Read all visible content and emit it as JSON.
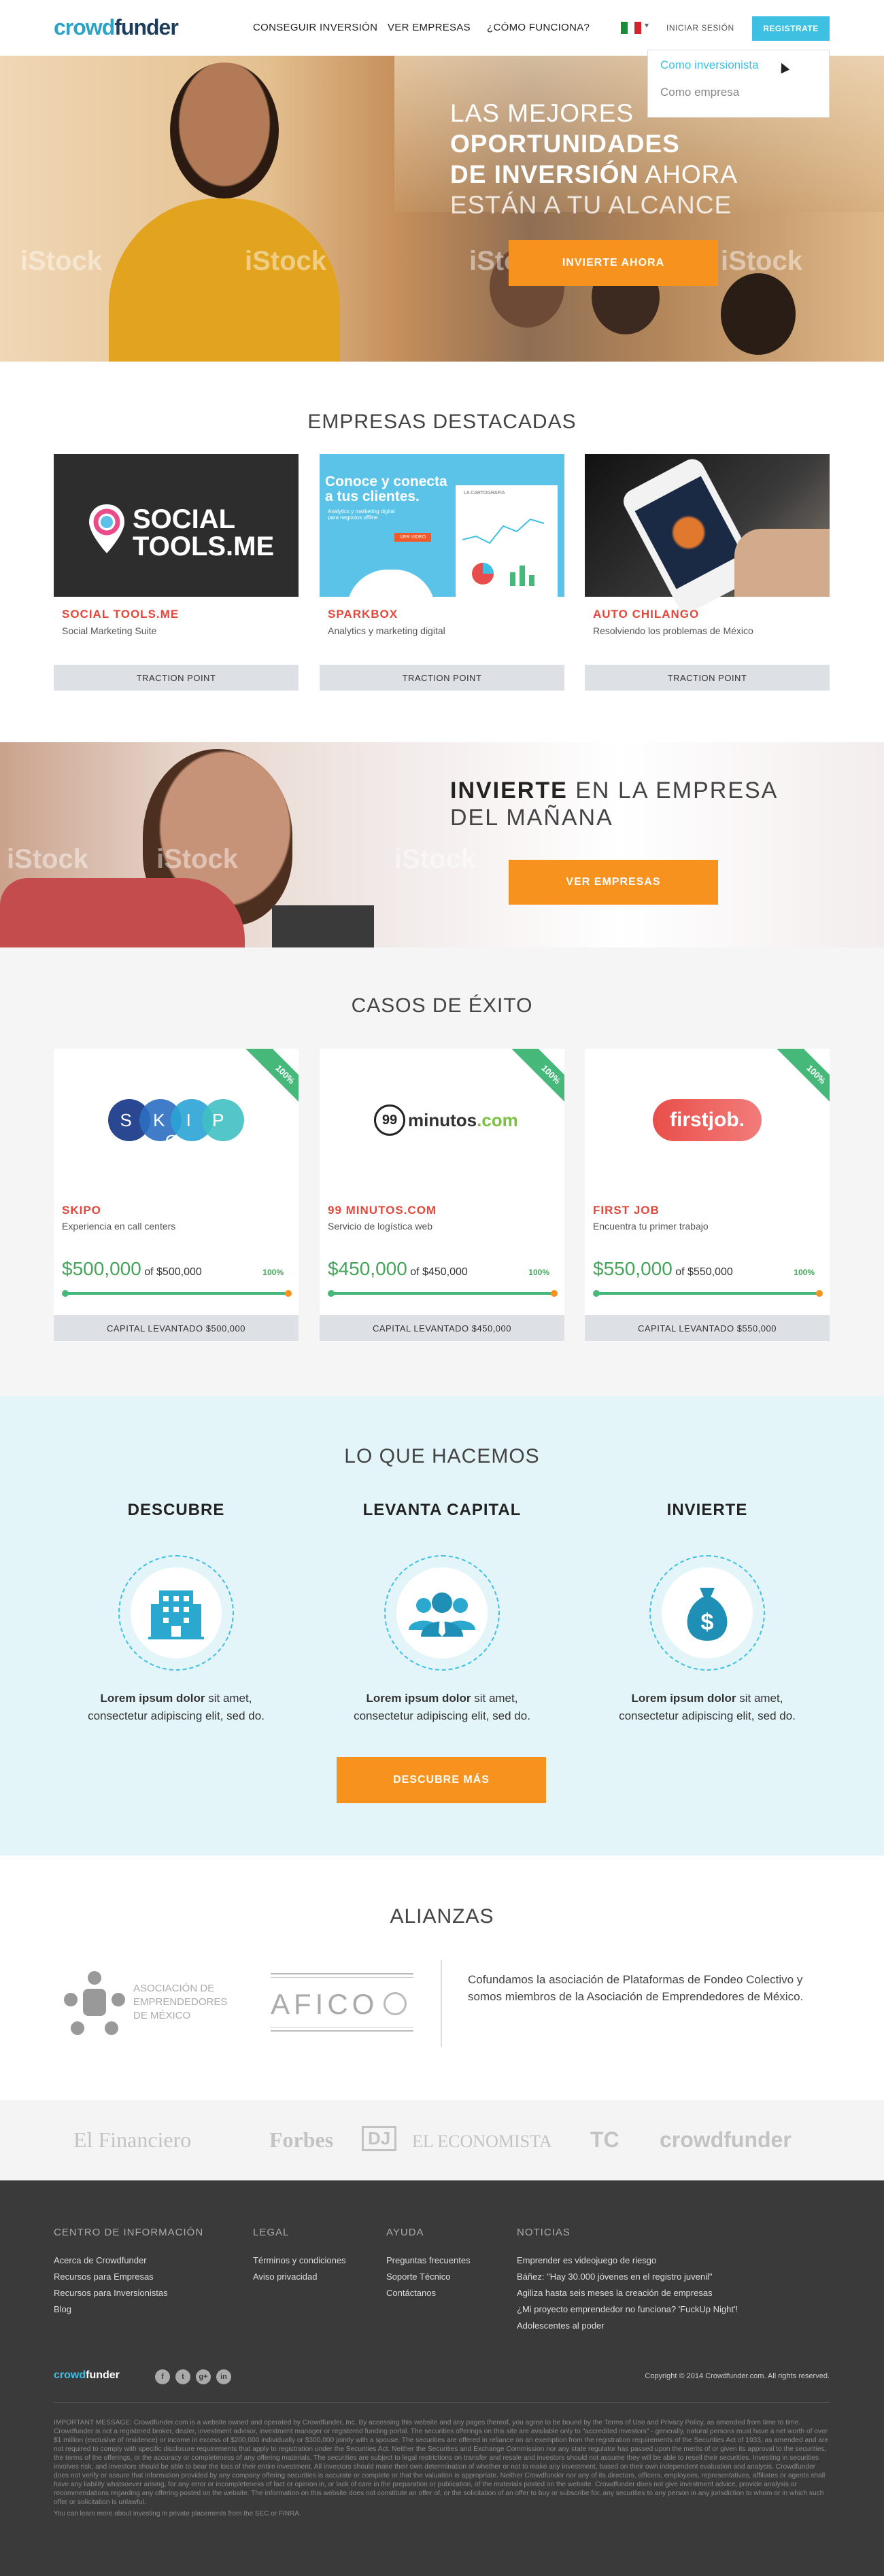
{
  "header": {
    "logo_part1": "crowd",
    "logo_part2": "funder",
    "nav": [
      "CONSEGUIR INVERSIÓN",
      "VER EMPRESAS",
      "¿CÓMO FUNCIONA?"
    ],
    "flag_caret": "▾",
    "login": "INICIAR SESIÓN",
    "register": "REGISTRATE",
    "dropdown": [
      "Como inversionista",
      "Como empresa"
    ]
  },
  "hero": {
    "line1": "LAS MEJORES",
    "line2": "OPORTUNIDADES",
    "line3a": "DE INVERSIÓN",
    "line3b": " AHORA",
    "line4": "ESTÁN A TU ALCANCE",
    "cta": "INVIERTE AHORA",
    "dots": "● ● ●",
    "watermark": "iStock"
  },
  "featured": {
    "title": "EMPRESAS DESTACADAS",
    "cards": [
      {
        "name": "SOCIAL TOOLS.ME",
        "desc": "Social Marketing Suite",
        "btn": "TRACTION POINT",
        "logo_l1": "SOCIAL",
        "logo_l2": "TOOLS.ME"
      },
      {
        "name": "SPARKBOX",
        "desc": "Analytics y marketing digital",
        "btn": "TRACTION POINT",
        "logo_l1": "Conoce y conecta",
        "logo_l2": "a tus clientes.",
        "logo_l3": "Analytics y marketing digital para negocios offline",
        "logo_btn": "VER VIDEO",
        "logo_tag": "LA CARTOGRAFIA"
      },
      {
        "name": "AUTO CHILANGO",
        "desc": "Resolviendo los problemas de México",
        "btn": "TRACTION POINT"
      }
    ]
  },
  "promo": {
    "bold": "INVIERTE",
    "rest1": " EN LA EMPRESA",
    "line2": "DEL MAÑANA",
    "cta": "VER EMPRESAS"
  },
  "success": {
    "title": "CASOS DE ÉXITO",
    "cards": [
      {
        "ribbon": "100%",
        "name": "SKIPO",
        "desc": "Experiencia en call centers",
        "raised": "$500,000",
        "goal": " of $500,000",
        "pct": "100%",
        "btn": "CAPITAL LEVANTADO $500,000",
        "logo": "S K I P O"
      },
      {
        "ribbon": "100%",
        "name": "99 MINUTOS.COM",
        "desc": "Servicio de logística web",
        "raised": "$450,000",
        "goal": " of $450,000",
        "pct": "100%",
        "btn": "CAPITAL LEVANTADO $450,000",
        "logo_num": "99",
        "logo_txt": "minutos",
        "logo_ext": ".com"
      },
      {
        "ribbon": "100%",
        "name": "FIRST JOB",
        "desc": "Encuentra tu primer trabajo",
        "raised": "$550,000",
        "goal": " of $550,000",
        "pct": "100%",
        "btn": "CAPITAL LEVANTADO $550,000",
        "logo": "firstjob."
      }
    ]
  },
  "what": {
    "title": "LO QUE HACEMOS",
    "cols": [
      {
        "title": "DESCUBRE",
        "bold": "Lorem ipsum dolor",
        "text": " sit amet,",
        "text2": "consectetur adipiscing elit, sed do."
      },
      {
        "title": "LEVANTA CAPITAL",
        "bold": "Lorem ipsum dolor",
        "text": " sit amet,",
        "text2": "consectetur adipiscing elit, sed do."
      },
      {
        "title": "INVIERTE",
        "bold": "Lorem ipsum dolor",
        "text": " sit amet,",
        "text2": "consectetur adipiscing elit, sed do."
      }
    ],
    "cta": "DESCUBRE MÁS",
    "dollar": "$"
  },
  "alianzas": {
    "title": "ALIANZAS",
    "asoc": [
      "ASOCIACIÓN DE",
      "EMPRENDEDORES",
      "DE MÉXICO"
    ],
    "afico": "AFICO",
    "text": "Cofundamos la asociación de Plataformas de Fondeo Colectivo y somos miembros de la Asociación de Emprendedores de México."
  },
  "press": [
    "El Financiero",
    "Forbes",
    "DJ",
    "EL ECONOMISTA",
    "TC",
    "crowdfunder"
  ],
  "footer": {
    "cols": [
      {
        "title": "CENTRO DE INFORMACIÓN",
        "links": [
          "Acerca de Crowdfunder",
          "Recursos para Empresas",
          "Recursos para Inversionistas",
          "Blog"
        ]
      },
      {
        "title": "LEGAL",
        "links": [
          "Términos y condiciones",
          "Aviso privacidad"
        ]
      },
      {
        "title": "AYUDA",
        "links": [
          "Preguntas frecuentes",
          "Soporte Técnico",
          "Contáctanos"
        ]
      },
      {
        "title": "NOTICIAS",
        "links": [
          "Emprender es videojuego de riesgo",
          "Báñez: \"Hay 30.000 jóvenes en el registro juvenil\"",
          "Agiliza hasta seis meses la creación de empresas",
          "¿Mi proyecto emprendedor no funciona? 'FuckUp Night'!",
          "Adolescentes al poder"
        ]
      }
    ],
    "social": [
      "f",
      "t",
      "g+",
      "in"
    ],
    "copyright": "Copyright © 2014 Crowdfunder.com. All rights reserved.",
    "legal": "IMPORTANT MESSAGE: Crowdfunder.com is a website owned and operated by Crowdfunder, Inc. By accessing this website and any pages thereof, you agree to be bound by the Terms of Use and Privacy Policy, as amended from time to time. Crowdfunder is not a registered broker, dealer, investment advisor, investment manager or registered funding portal. The securities offerings on this site are available only to \"accredited investors\" - generally, natural persons must have a net worth of over $1 million (exclusive of residence) or income in excess of $200,000 individually or $300,000 jointly with a spouse. The securities are offered in reliance on an exemption from the registration requirements of the Securities Act of 1933, as amended and are not required to comply with specific disclosure requirements that apply to registration under the Securities Act. Neither the Securities and Exchange Commission nor any state regulator has passed upon the merits of or given its approval to the securities, the terms of the offerings, or the accuracy or completeness of any offering materials. The securities are subject to legal restrictions on transfer and resale and investors should not assume they will be able to resell their securities. Investing in securities involves risk, and investors should be able to bear the loss of their entire investment. All investors should make their own determination of whether or not to make any investment, based on their own independent evaluation and analysis. Crowdfunder does not verify or assure that information provided by any company offering securities is accurate or complete or that the valuation is appropriate. Neither Crowdfunder nor any of its directors, officers, employees, representatives, affiliates or agents shall have any liability whatsoever arising, for any error or incompleteness of fact or opinion in, or lack of care in the preparation or publication, of the materials posted on the website. Crowdfunder does not give investment advice, provide analysis or recommendations regarding any offering posted on the website. The information on this website does not constitute an offer of, or the solicitation of an offer to buy or subscribe for, any securities to any person in any jurisdiction to whom or in which such offer or solicitation is unlawful.",
    "legal2": "You can learn more about investing in private placements from the SEC or FINRA."
  },
  "colors": {
    "accent": "#3ec0e3",
    "orange": "#f7921e",
    "red": "#e2473b",
    "green": "#46a35a",
    "footer_bg": "#3a3a3a"
  }
}
